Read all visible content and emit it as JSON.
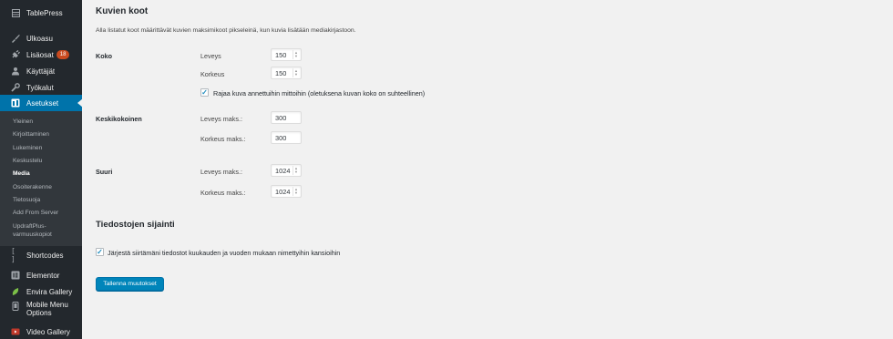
{
  "sidebar": {
    "items": [
      {
        "label": "TablePress",
        "icon": "table-icon"
      },
      {
        "label": "Ulkoasu",
        "icon": "paintbrush-icon"
      },
      {
        "label": "Lisäosat",
        "icon": "plugin-icon",
        "badge": "18"
      },
      {
        "label": "Käyttäjät",
        "icon": "users-icon"
      },
      {
        "label": "Työkalut",
        "icon": "wrench-icon"
      },
      {
        "label": "Asetukset",
        "icon": "settings-icon",
        "active": true
      },
      {
        "label": "Shortcodes",
        "icon": "brackets-icon"
      },
      {
        "label": "Elementor",
        "icon": "elementor-icon"
      },
      {
        "label": "Envira Gallery",
        "icon": "leaf-icon"
      },
      {
        "label": "Mobile Menu Options",
        "label_line1": "Mobile Menu",
        "label_line2": "Options",
        "icon": "mobile-icon"
      },
      {
        "label": "Video Gallery",
        "icon": "video-icon"
      }
    ],
    "submenu": [
      "Yleinen",
      "Kirjoittaminen",
      "Lukeminen",
      "Keskustelu",
      "Media",
      "Osoiterakenne",
      "Tietosuoja",
      "Add From Server",
      "UpdraftPlus-varmuuskopiot"
    ],
    "submenu_split": {
      "line1": "UpdraftPlus-",
      "line2": "varmuuskopiot"
    },
    "current_submenu": "Media"
  },
  "page": {
    "section_title": "Kuvien koot",
    "section_desc": "Alla listatut koot määrittävät kuvien maksimikoot pikseleinä, kun kuvia lisätään mediakirjastoon.",
    "sizes": {
      "thumb": {
        "label": "Koko",
        "width_label": "Leveys",
        "width": "150",
        "height_label": "Korkeus",
        "height": "150",
        "crop_label": "Rajaa kuva annettuihin mittoihin (oletuksena kuvan koko on suhteellinen)",
        "crop_checked": true
      },
      "medium": {
        "label": "Keskikokoinen",
        "width_label": "Leveys maks.:",
        "width": "300",
        "height_label": "Korkeus maks.:",
        "height": "300"
      },
      "large": {
        "label": "Suuri",
        "width_label": "Leveys maks.:",
        "width": "1024",
        "height_label": "Korkeus maks.:",
        "height": "1024"
      }
    },
    "uploads_title": "Tiedostojen sijainti",
    "uploads_checkbox_label": "Järjestä siirtämäni tiedostot kuukauden ja vuoden mukaan nimettyihin kansioihin",
    "uploads_checked": true,
    "save_button": "Tallenna muutokset"
  },
  "colors": {
    "sidebar_bg": "#23282d",
    "submenu_bg": "#32373c",
    "accent": "#0073aa",
    "button": "#0085ba",
    "badge": "#ca4a1f",
    "page_bg": "#f1f1f1"
  }
}
